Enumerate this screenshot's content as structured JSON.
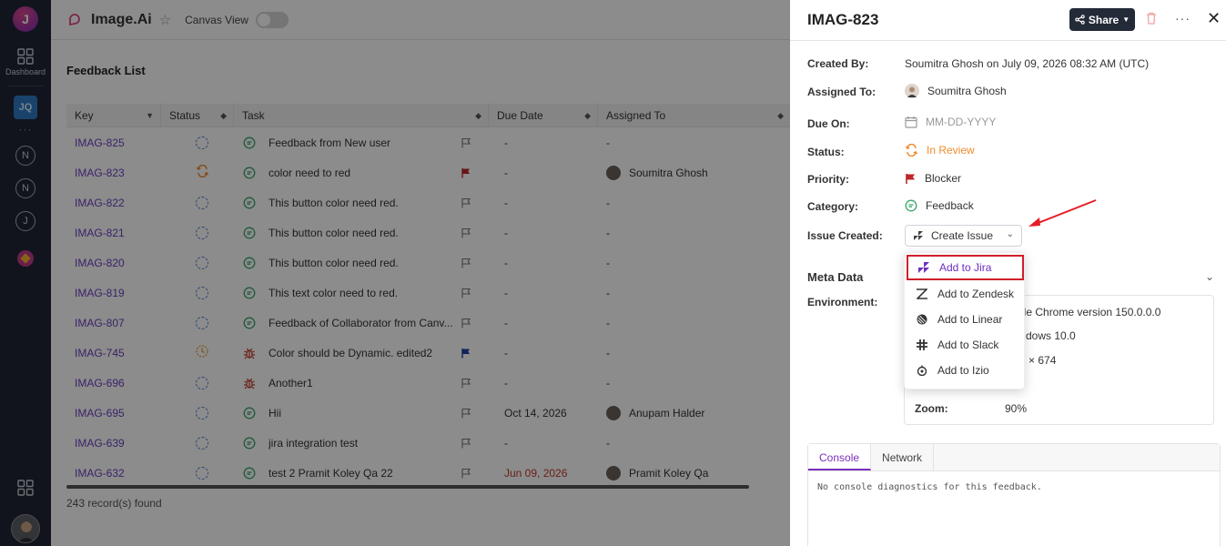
{
  "app": {
    "brand": "Image.Ai",
    "canvas_view_label": "Canvas View",
    "logo_letter": "J"
  },
  "sidebar": {
    "dashboard_label": "Dashboard",
    "project_badge": "JQ",
    "items": [
      "N",
      "N",
      "J"
    ]
  },
  "list": {
    "title": "Feedback List",
    "columns": [
      "Key",
      "Status",
      "Task",
      "Due Date",
      "Assigned To"
    ],
    "rows": [
      {
        "key": "IMAG-825",
        "task": "Feedback from New user",
        "due": "-",
        "assignee": "-"
      },
      {
        "key": "IMAG-823",
        "task": "color need to red",
        "due": "-",
        "assignee": "Soumitra Ghosh"
      },
      {
        "key": "IMAG-822",
        "task": "This button color need red.",
        "due": "-",
        "assignee": "-"
      },
      {
        "key": "IMAG-821",
        "task": "This button color need red.",
        "due": "-",
        "assignee": "-"
      },
      {
        "key": "IMAG-820",
        "task": "This button color need red.",
        "due": "-",
        "assignee": "-"
      },
      {
        "key": "IMAG-819",
        "task": "This text color need to red.",
        "due": "-",
        "assignee": "-"
      },
      {
        "key": "IMAG-807",
        "task": "Feedback of Collaborator from Canv...",
        "due": "-",
        "assignee": "-"
      },
      {
        "key": "IMAG-745",
        "task": "Color should be Dynamic. edited2",
        "due": "-",
        "assignee": "-"
      },
      {
        "key": "IMAG-696",
        "task": "Another1",
        "due": "-",
        "assignee": "-"
      },
      {
        "key": "IMAG-695",
        "task": "Hii",
        "due": "Oct 14, 2026",
        "assignee": "Anupam Halder"
      },
      {
        "key": "IMAG-639",
        "task": "jira integration test",
        "due": "-",
        "assignee": "-"
      },
      {
        "key": "IMAG-632",
        "task": "test 2 Pramit Koley Qa 22",
        "due": "Jun 09, 2026",
        "assignee": "Pramit Koley Qa"
      }
    ],
    "records_found": "243 record(s) found"
  },
  "drawer": {
    "title": "IMAG-823",
    "share_label": "Share",
    "fields": {
      "created_by_label": "Created By:",
      "created_by_value": "Soumitra Ghosh on July 09, 2026 08:32 AM (UTC)",
      "assigned_to_label": "Assigned To:",
      "assigned_to_value": "Soumitra Ghosh",
      "due_on_label": "Due On:",
      "due_on_placeholder": "MM-DD-YYYY",
      "status_label": "Status:",
      "status_value": "In Review",
      "priority_label": "Priority:",
      "priority_value": "Blocker",
      "category_label": "Category:",
      "category_value": "Feedback",
      "issue_created_label": "Issue Created:",
      "create_issue_label": "Create Issue"
    },
    "meta": {
      "title": "Meta Data",
      "environment_label": "Environment:",
      "browser_partial": "gle Chrome version 150.0.0.0",
      "os_partial": "dows 10.0",
      "resolution_partial": "× 674",
      "zoom_label": "Zoom:",
      "zoom_value": "90%"
    },
    "tabs": [
      "Console",
      "Network"
    ],
    "console_message": "No console diagnostics for this feedback."
  },
  "dropdown": {
    "items": [
      "Add to Jira",
      "Add to Zendesk",
      "Add to Linear",
      "Add to Slack",
      "Add to Izio"
    ]
  },
  "colors": {
    "accent": "#6b2fc0",
    "sidebar_bg": "#1f2633",
    "highlight_border": "#d11f2a",
    "status_orange": "#f08c2e"
  }
}
